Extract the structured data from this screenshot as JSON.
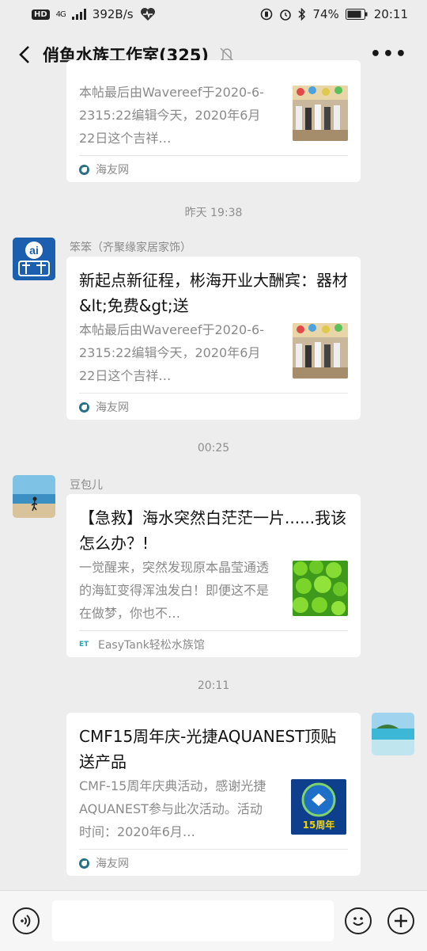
{
  "status_bar": {
    "hd": "HD",
    "network": "4G",
    "speed": "392B/s",
    "battery": "74%",
    "time": "20:11"
  },
  "header": {
    "title": "俏鱼水族工作室(325)",
    "more": "•••"
  },
  "messages": [
    {
      "card_desc": "本帖最后由Wavereef于2020-6-2315:22编辑今天，2020年6月22日这个吉祥…",
      "source": "海友网"
    },
    {
      "time": "昨天 19:38",
      "sender": "笨笨（齐聚缘家居家饰）",
      "avatar_text": "ai",
      "card_title": "新起点新征程，彬海开业大酬宾：器材&lt;免费&gt;送",
      "card_desc": "本帖最后由Wavereef于2020-6-2315:22编辑今天，2020年6月22日这个吉祥…",
      "source": "海友网"
    },
    {
      "time": "00:25",
      "sender": "豆包儿",
      "card_title": "【急救】海水突然白茫茫一片......我该怎么办？!",
      "card_desc": "一觉醒来，突然发现原本晶莹通透的海缸变得浑浊发白！即便这不是在做梦，你也不…",
      "source": "EasyTank轻松水族馆"
    },
    {
      "time": "20:11",
      "card_title": "CMF15周年庆-光捷AQUANEST顶贴送产品",
      "card_desc": "CMF-15周年庆典活动，感谢光捷AQUANEST参与此次活动。活动时间：2020年6月…",
      "thumb_text": "15周年",
      "source": "海友网"
    }
  ],
  "icons": {
    "back": "back-arrow-icon",
    "mute": "bell-off-icon",
    "voice": "voice-icon",
    "emoji": "emoji-icon",
    "plus": "plus-icon"
  }
}
